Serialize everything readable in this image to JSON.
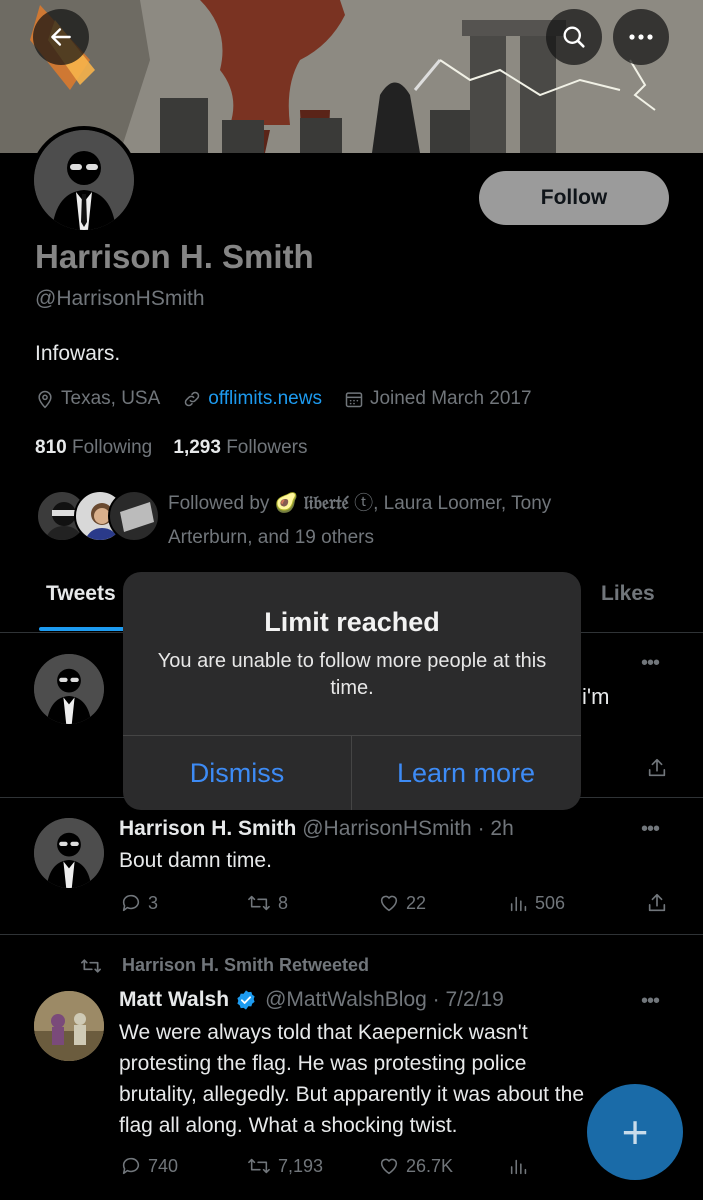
{
  "header": {
    "back_icon": "arrow-left-icon",
    "search_icon": "search-icon",
    "more_icon": "more-horizontal-icon"
  },
  "profile": {
    "name": "Harrison H. Smith",
    "handle": "@HarrisonHSmith",
    "bio": "Infowars.",
    "location": "Texas, USA",
    "website": "offlimits.news",
    "joined": "Joined March 2017",
    "following_count": "810",
    "following_label": "Following",
    "followers_count": "1,293",
    "followers_label": "Followers",
    "followed_by_prefix": "Followed by 🥑",
    "followed_by_liberte": "𝔩𝔦𝔟𝔢𝔯𝔱𝔢́",
    "followed_by_badge": "ⓣ",
    "followed_by_rest": ", Laura Loomer, Tony",
    "followed_by_line2": "Arterburn, and 19 others",
    "follow_button": "Follow"
  },
  "tabs": {
    "tweets": "Tweets",
    "likes": "Likes"
  },
  "tweets": [
    {
      "partial_text_right": "i'm"
    },
    {
      "name": "Harrison H. Smith",
      "handle_time": "@HarrisonHSmith · 2h",
      "text": "Bout damn time.",
      "replies": "3",
      "retweets": "8",
      "likes": "22",
      "views": "506"
    },
    {
      "retweeted_by": "Harrison H. Smith Retweeted",
      "name": "Matt Walsh",
      "handle_time": "@MattWalshBlog · 7/2/19",
      "text": "We were always told that Kaepernick wasn't protesting the flag. He was protesting police brutality, allegedly. But apparently it was about the flag all along. What a shocking twist.",
      "replies": "740",
      "retweets": "7,193",
      "likes": "26.7K"
    }
  ],
  "dialog": {
    "title": "Limit reached",
    "message": "You are unable to follow more people at this time.",
    "dismiss": "Dismiss",
    "learn_more": "Learn more"
  },
  "fab": {
    "label": "+"
  },
  "colors": {
    "accent": "#1d9bf0",
    "dialog_button": "#3d8bf5",
    "verified": "#1d9bf0"
  }
}
